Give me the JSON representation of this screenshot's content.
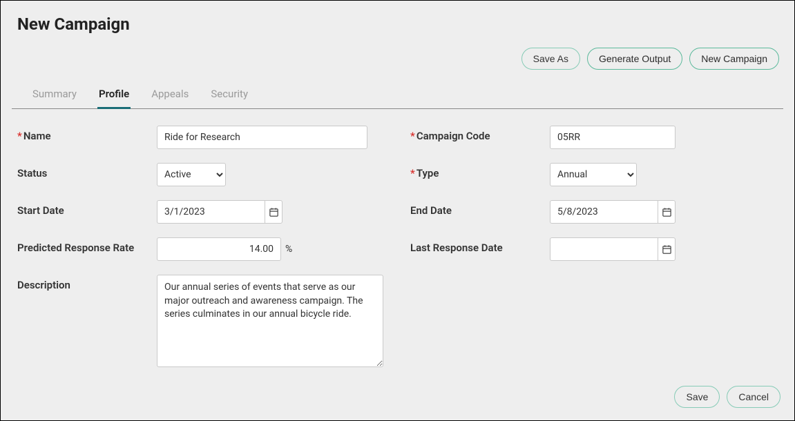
{
  "header": {
    "title": "New Campaign"
  },
  "actions": {
    "saveAs": "Save As",
    "generateOutput": "Generate Output",
    "newCampaign": "New Campaign",
    "save": "Save",
    "cancel": "Cancel"
  },
  "tabs": {
    "summary": "Summary",
    "profile": "Profile",
    "appeals": "Appeals",
    "security": "Security"
  },
  "form": {
    "nameLabel": "Name",
    "nameValue": "Ride for Research",
    "campaignCodeLabel": "Campaign Code",
    "campaignCodeValue": "05RR",
    "statusLabel": "Status",
    "statusValue": "Active",
    "typeLabel": "Type",
    "typeValue": "Annual",
    "startDateLabel": "Start Date",
    "startDateValue": "3/1/2023",
    "endDateLabel": "End Date",
    "endDateValue": "5/8/2023",
    "predictedLabel": "Predicted Response Rate",
    "predictedValue": "14.00",
    "percentSymbol": "%",
    "lastResponseLabel": "Last Response Date",
    "lastResponseValue": "",
    "descriptionLabel": "Description",
    "descriptionValue": "Our annual series of events that serve as our major outreach and awareness campaign. The series culminates in our annual bicycle ride."
  }
}
